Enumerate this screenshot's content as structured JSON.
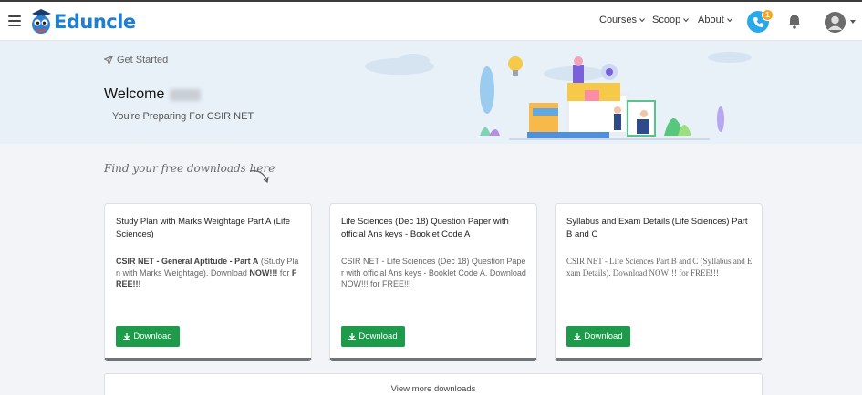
{
  "header": {
    "brand": "Eduncle",
    "nav": [
      {
        "label": "Courses"
      },
      {
        "label": "Scoop"
      },
      {
        "label": "About"
      }
    ],
    "call_badge_count": "1",
    "brand_color": "#1f7fd1"
  },
  "hero": {
    "get_started": "Get Started",
    "welcome": "Welcome",
    "preparing": "You're Preparing For CSIR NET",
    "background": "#e8f0f8"
  },
  "downloads": {
    "heading": "Find your free downloads here",
    "cards": [
      {
        "title": "Study Plan with Marks Weightage Part A (Life Sciences)",
        "desc_parts": {
          "b1": "CSIR NET - General Aptitude - Part A",
          "t1": " (Study Plan with Marks Weightage). Download ",
          "b2": "NOW!!!",
          "t2": " for ",
          "b3": "FREE!!!"
        },
        "button": "Download"
      },
      {
        "title": "Life Sciences (Dec 18) Question Paper with official Ans keys - Booklet Code A",
        "desc": "CSIR NET - Life Sciences (Dec 18) Question Paper with official Ans keys - Booklet Code A. Download NOW!!! for FREE!!!",
        "button": "Download"
      },
      {
        "title": "Syllabus and Exam Details (Life Sciences) Part B and C",
        "desc": "CSIR NET - Life Sciences Part B and C (Syllabus and Exam Details). Download NOW!!! for FREE!!!",
        "button": "Download"
      }
    ],
    "view_more": "View more downloads",
    "button_color": "#1e9a4b"
  }
}
